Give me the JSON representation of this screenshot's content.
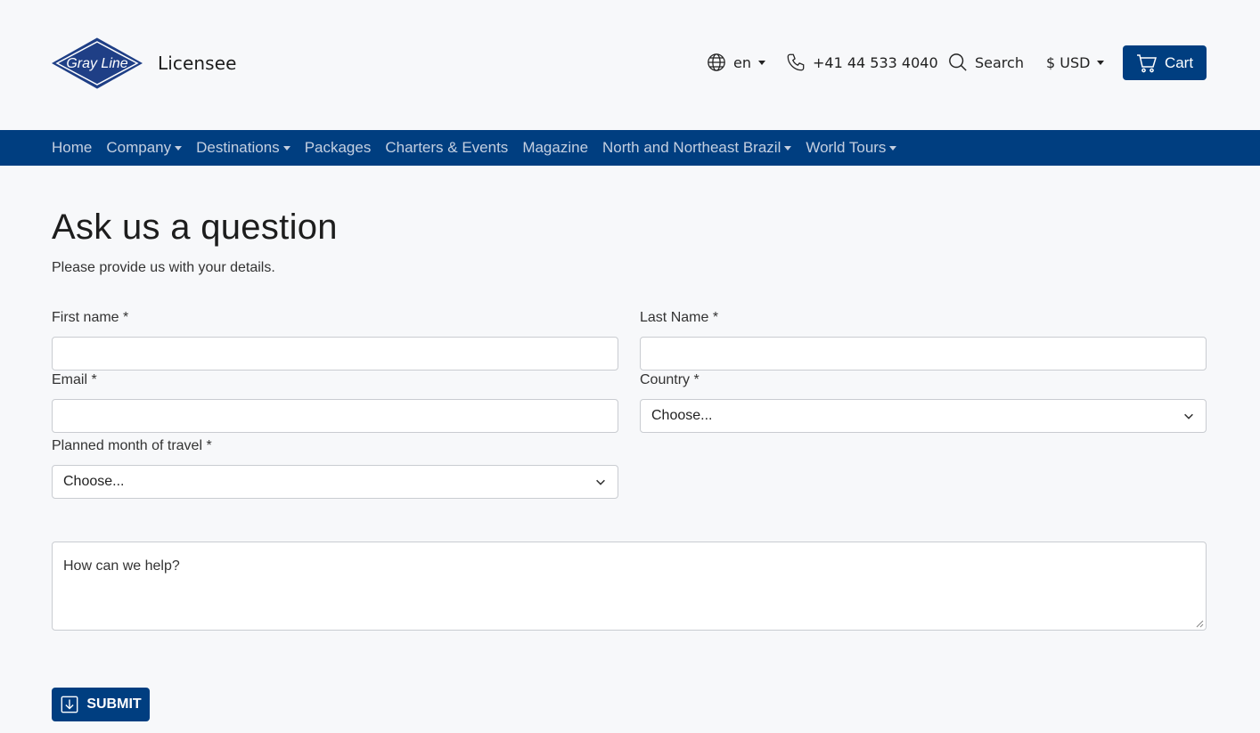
{
  "colors": {
    "brand": "#003e80",
    "nav_text": "#c4cfe0",
    "background": "#f7f8fa"
  },
  "header": {
    "logo_text": "Gray Line",
    "licensee": "Licensee",
    "language": "en",
    "phone": "+41 44 533 4040",
    "search": "Search",
    "currency": "$ USD",
    "cart": "Cart"
  },
  "nav": {
    "items": [
      {
        "label": "Home",
        "dropdown": false
      },
      {
        "label": "Company",
        "dropdown": true
      },
      {
        "label": "Destinations",
        "dropdown": true
      },
      {
        "label": "Packages",
        "dropdown": false
      },
      {
        "label": "Charters & Events",
        "dropdown": false
      },
      {
        "label": "Magazine",
        "dropdown": false
      },
      {
        "label": "North and Northeast Brazil",
        "dropdown": true
      },
      {
        "label": "World Tours",
        "dropdown": true
      }
    ]
  },
  "form": {
    "title": "Ask us a question",
    "subtitle": "Please provide us with your details.",
    "first_name_label": "First name *",
    "first_name_value": "",
    "last_name_label": "Last Name *",
    "last_name_value": "",
    "email_label": "Email *",
    "email_value": "",
    "country_label": "Country *",
    "country_selected": "Choose...",
    "month_label": "Planned month of travel *",
    "month_selected": "Choose...",
    "message_placeholder": "How can we help?",
    "submit": "SUBMIT"
  }
}
